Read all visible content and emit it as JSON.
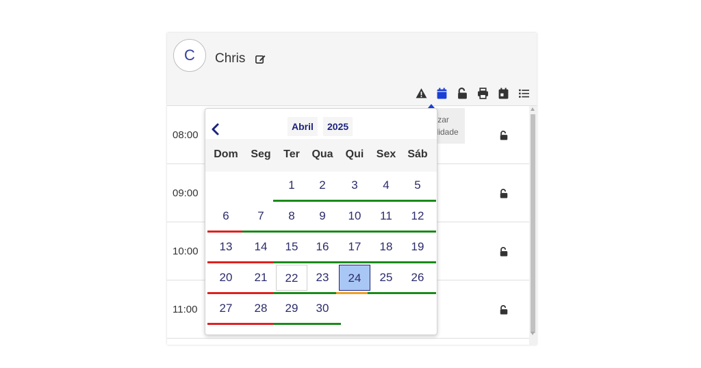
{
  "user": {
    "initial": "C",
    "name": "Chris"
  },
  "tooltip": {
    "line1": "Visualizar",
    "line2": "disponibilidade"
  },
  "rows": [
    {
      "time": "08:00"
    },
    {
      "time": "09:00"
    },
    {
      "time": "10:00"
    },
    {
      "time": "11:00"
    }
  ],
  "calendar": {
    "month": "Abril",
    "year": "2025",
    "weekdays": [
      "Dom",
      "Seg",
      "Ter",
      "Qua",
      "Qui",
      "Sex",
      "Sáb"
    ],
    "first_weekday_index": 2,
    "selected_day": 24,
    "today_day": 22,
    "days": [
      {
        "d": "1",
        "status": "green"
      },
      {
        "d": "2",
        "status": "green"
      },
      {
        "d": "3",
        "status": "green"
      },
      {
        "d": "4",
        "status": "green"
      },
      {
        "d": "5",
        "status": "green"
      },
      {
        "d": "6",
        "status": "red"
      },
      {
        "d": "7",
        "status": "green"
      },
      {
        "d": "8",
        "status": "green"
      },
      {
        "d": "9",
        "status": "green"
      },
      {
        "d": "10",
        "status": "green"
      },
      {
        "d": "11",
        "status": "green"
      },
      {
        "d": "12",
        "status": "green"
      },
      {
        "d": "13",
        "status": "red"
      },
      {
        "d": "14",
        "status": "red"
      },
      {
        "d": "15",
        "status": "green"
      },
      {
        "d": "16",
        "status": "green"
      },
      {
        "d": "17",
        "status": "green"
      },
      {
        "d": "18",
        "status": "green"
      },
      {
        "d": "19",
        "status": "green"
      },
      {
        "d": "20",
        "status": "red"
      },
      {
        "d": "21",
        "status": "red"
      },
      {
        "d": "22",
        "status": "green"
      },
      {
        "d": "23",
        "status": "green"
      },
      {
        "d": "24",
        "status": "orange"
      },
      {
        "d": "25",
        "status": "green"
      },
      {
        "d": "26",
        "status": "green"
      },
      {
        "d": "27",
        "status": "red"
      },
      {
        "d": "28",
        "status": "red"
      },
      {
        "d": "29",
        "status": "green"
      },
      {
        "d": "30",
        "status": "green"
      }
    ]
  },
  "colors": {
    "green": "#1a8a1a",
    "red": "#e02020",
    "orange": "#f0a020",
    "accent_blue": "#1a3fd6",
    "selected_bg": "#a9c7f5"
  },
  "icons": {
    "toolbar": [
      "warning-icon",
      "calendar-icon",
      "unlock-icon",
      "print-icon",
      "calendar-check-icon",
      "list-icon"
    ],
    "row_status": "unlock-icon"
  }
}
